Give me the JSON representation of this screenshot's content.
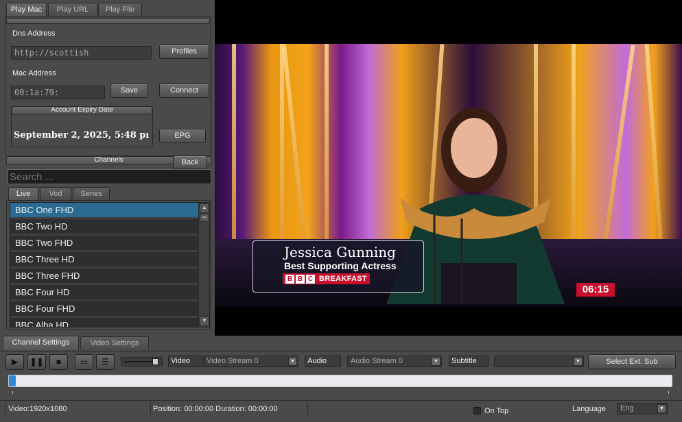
{
  "left_panel": {
    "tabs": [
      "Play Mac",
      "Play URL",
      "Play File"
    ],
    "dns_label": "Dns Address",
    "dns_value": "http://scottish",
    "profiles_button": "Profiles",
    "mac_label": "Mac Address",
    "mac_value": "00:1a:79:",
    "save_button": "Save",
    "connect_button": "Connect",
    "expiry_header": "Account Expiry Date",
    "expiry_value": "September 2, 2025, 5:48 pı",
    "epg_button": "EPG",
    "channels_header": "Channels",
    "back_button": "Back",
    "search_placeholder": "Search ...",
    "channel_tabs": [
      "Live",
      "Vod",
      "Series"
    ],
    "channels": [
      "BBC One FHD",
      "BBC Two HD",
      "BBC Two FHD",
      "BBC Three HD",
      "BBC Three FHD",
      "BBC Four HD",
      "BBC Four FHD",
      "BBC Alba HD"
    ]
  },
  "bottom_tabs": [
    "Channel Settings",
    "Video Settings"
  ],
  "video_overlay": {
    "name": "Jessica Gunning",
    "role": "Best Supporting Actress",
    "bbc_letters": [
      "B",
      "B",
      "C"
    ],
    "bbc_word": "BREAKFAST",
    "clock": "06:15"
  },
  "controls": {
    "video_label": "Video",
    "video_stream": "Video Stream 0",
    "audio_label": "Audio",
    "audio_stream": "Audio Stream 0",
    "subtitle_label": "Subtitle",
    "subtitle_value": "",
    "select_ext_sub": "Select Ext. Sub",
    "volume": 0.9,
    "seek_position": 0.0
  },
  "status": {
    "video_info": "Video:1920x1080",
    "position_info": "Position: 00:00:00 Duration: 00:00:00",
    "on_top_label": "On Top",
    "language_label": "Language",
    "language_value": "Eng"
  },
  "colors": {
    "selected_channel": "#2b6a93",
    "bbc_red": "#c8102e",
    "seek_thumb": "#2f86d6"
  }
}
